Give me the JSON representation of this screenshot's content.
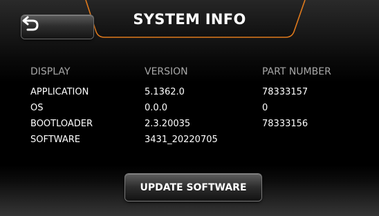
{
  "header": {
    "title": "SYSTEM INFO",
    "back_icon": "back-arrow-icon",
    "accent_color": "#e07a1c"
  },
  "table": {
    "columns": [
      "DISPLAY",
      "VERSION",
      "PART NUMBER"
    ],
    "rows": [
      {
        "display": "APPLICATION",
        "version": "5.1362.0",
        "part_number": "78333157"
      },
      {
        "display": "OS",
        "version": "0.0.0",
        "part_number": "0"
      },
      {
        "display": "BOOTLOADER",
        "version": "2.3.20035",
        "part_number": "78333156"
      },
      {
        "display": "SOFTWARE",
        "version": "3431_20220705",
        "part_number": ""
      }
    ]
  },
  "footer": {
    "update_label": "UPDATE SOFTWARE"
  }
}
